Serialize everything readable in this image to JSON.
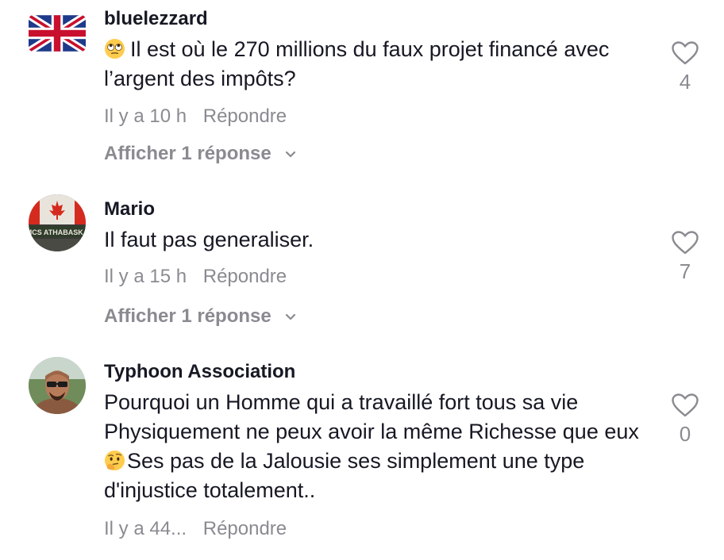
{
  "comments": [
    {
      "username": "bluelezzard",
      "avatar_icon": "uk-flag-icon",
      "emoji_icon": "eye-roll-emoji-icon",
      "text": "Il est où le 270 millions du faux projet financé avec l’argent des impôts?",
      "time": "Il y a 10 h",
      "reply_label": "Répondre",
      "view_replies_label": "Afficher 1 réponse",
      "like_count": "4"
    },
    {
      "username": "Mario",
      "avatar_icon": "canada-flag-banner-avatar",
      "text": "Il faut pas generaliser.",
      "time": "Il y a 15 h",
      "reply_label": "Répondre",
      "view_replies_label": "Afficher 1 réponse",
      "like_count": "7"
    },
    {
      "username": "Typhoon Association",
      "avatar_icon": "man-sunglasses-avatar",
      "emoji_icon": "thinking-face-emoji-icon",
      "text_before_emoji": "Pourquoi un Homme qui a travaillé fort tous sa vie Physiquement ne peux avoir la même Richesse que eux",
      "text_after_emoji": "Ses pas de la Jalousie ses simplement une type d'injustice totalement..",
      "time": "Il y a 44...",
      "reply_label": "Répondre",
      "like_count": "0"
    }
  ],
  "colors": {
    "text_primary": "#161823",
    "text_secondary": "#8a8b91",
    "icon_gray": "#8a8b91"
  }
}
